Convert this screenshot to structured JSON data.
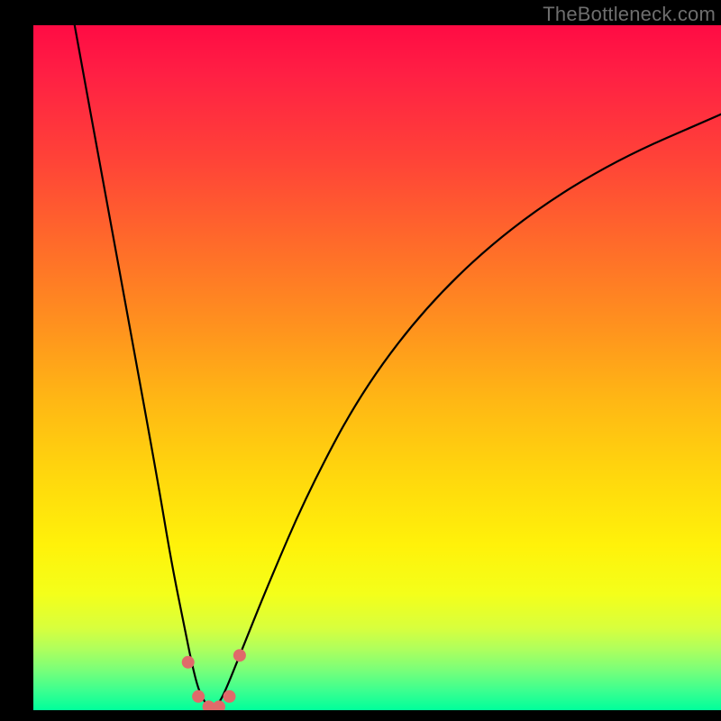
{
  "watermark": "TheBottleneck.com",
  "chart_data": {
    "type": "line",
    "title": "",
    "xlabel": "",
    "ylabel": "",
    "xlim": [
      0,
      100
    ],
    "ylim": [
      0,
      100
    ],
    "gradient_stops": [
      {
        "pos": 0,
        "color": "#ff0b44"
      },
      {
        "pos": 7,
        "color": "#ff1f44"
      },
      {
        "pos": 20,
        "color": "#ff4437"
      },
      {
        "pos": 32,
        "color": "#ff6b2a"
      },
      {
        "pos": 44,
        "color": "#ff921e"
      },
      {
        "pos": 55,
        "color": "#ffb814"
      },
      {
        "pos": 66,
        "color": "#ffd80d"
      },
      {
        "pos": 76,
        "color": "#fff20a"
      },
      {
        "pos": 83,
        "color": "#f4ff1a"
      },
      {
        "pos": 88,
        "color": "#d8ff3d"
      },
      {
        "pos": 91,
        "color": "#b0ff5c"
      },
      {
        "pos": 94,
        "color": "#7cff78"
      },
      {
        "pos": 97,
        "color": "#3fff8f"
      },
      {
        "pos": 100,
        "color": "#00ff9b"
      }
    ],
    "series": [
      {
        "name": "bottleneck-curve",
        "color": "#000000",
        "x": [
          6,
          10,
          14,
          18,
          20,
          22,
          23,
          24,
          25,
          26,
          27,
          28,
          30,
          34,
          40,
          48,
          58,
          70,
          84,
          100
        ],
        "y": [
          100,
          78,
          56,
          34,
          22,
          12,
          7,
          3,
          1,
          0,
          1,
          3,
          8,
          18,
          32,
          47,
          60,
          71,
          80,
          87
        ]
      }
    ],
    "markers": {
      "name": "trough-markers",
      "color": "#e06a6a",
      "radius": 7,
      "points": [
        {
          "x": 22.5,
          "y": 7
        },
        {
          "x": 24.0,
          "y": 2
        },
        {
          "x": 25.5,
          "y": 0.5
        },
        {
          "x": 27.0,
          "y": 0.5
        },
        {
          "x": 28.5,
          "y": 2
        },
        {
          "x": 30.0,
          "y": 8
        }
      ]
    }
  }
}
